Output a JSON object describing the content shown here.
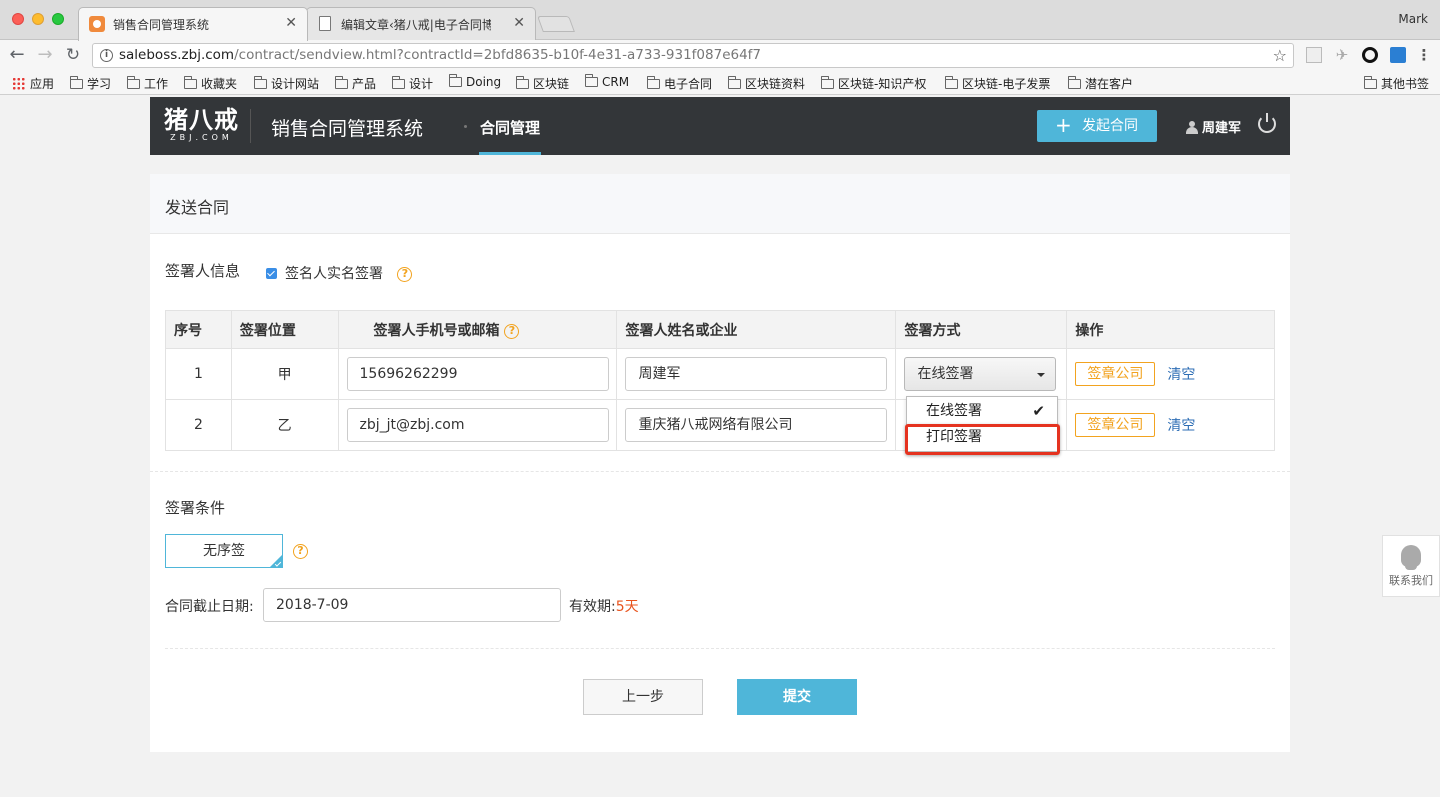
{
  "browser": {
    "tabs": [
      {
        "title": "销售合同管理系统",
        "active": true
      },
      {
        "title": "编辑文章‹猪八戒|电子合同博客",
        "active": false
      }
    ],
    "profile": "Mark",
    "url_host": "saleboss.zbj.com",
    "url_path": "/contract/sendview.html?contractId=2bfd8635-b10f-4e31-a733-931f087e64f7",
    "bookmarks": [
      "应用",
      "学习",
      "工作",
      "收藏夹",
      "设计网站",
      "产品",
      "设计",
      "Doing",
      "区块链",
      "CRM",
      "电子合同",
      "区块链资料",
      "区块链-知识产权",
      "区块链-电子发票",
      "潜在客户"
    ],
    "other_bookmarks": "其他书签"
  },
  "header": {
    "logo_main": "猪八戒",
    "logo_sub": "ZBJ.COM",
    "system_title": "销售合同管理系统",
    "nav_active": "合同管理",
    "launch_button": "发起合同",
    "user_name": "周建军"
  },
  "card": {
    "title": "发送合同",
    "signer_section_title": "签署人信息",
    "realname_checkbox_label": "签名人实名签署",
    "realname_checked": true,
    "table": {
      "headers": [
        "序号",
        "签署位置",
        "签署人手机号或邮箱",
        "签署人姓名或企业",
        "签署方式",
        "操作"
      ],
      "rows": [
        {
          "no": "1",
          "position": "甲",
          "contact": "15696262299",
          "name": "周建军",
          "method": "在线签署",
          "seal": "签章公司",
          "clear": "清空"
        },
        {
          "no": "2",
          "position": "乙",
          "contact": "zbj_jt@zbj.com",
          "name": "重庆猪八戒网络有限公司",
          "method": "在线签署",
          "seal": "签章公司",
          "clear": "清空"
        }
      ]
    },
    "dropdown_options": [
      "在线签署",
      "打印签署"
    ],
    "dropdown_selected": "在线签署",
    "condition_section_title": "签署条件",
    "order_option": "无序签",
    "deadline_label": "合同截止日期:",
    "deadline_value": "2018-7-09",
    "validity_label": "有效期:",
    "validity_value": "5天",
    "prev_button": "上一步",
    "submit_button": "提交"
  },
  "contact_float": "联系我们",
  "colors": {
    "accent": "#4fb6d9",
    "warning": "#f2a31f",
    "highlight": "#e53320",
    "header_bg": "#333639"
  }
}
